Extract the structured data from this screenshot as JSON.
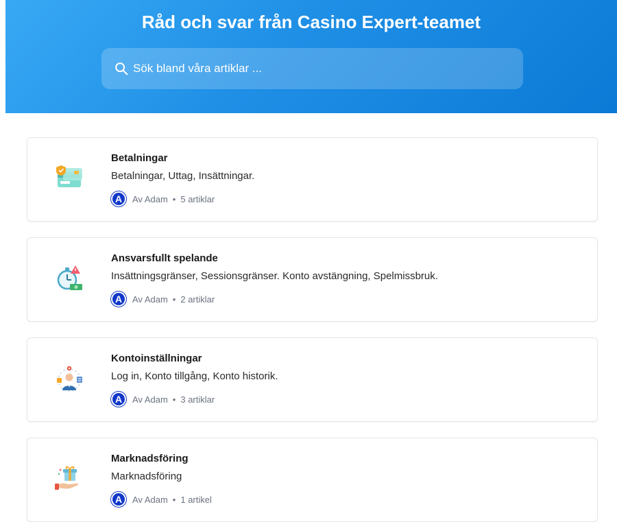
{
  "header": {
    "title": "Råd och svar från Casino Expert-teamet",
    "search_placeholder": "Sök bland våra artiklar ..."
  },
  "categories": [
    {
      "title": "Betalningar",
      "description": "Betalningar, Uttag, Insättningar.",
      "author_initial": "A",
      "author": "Av Adam",
      "separator": "•",
      "count": "5 artiklar",
      "icon": "payment-card-icon"
    },
    {
      "title": "Ansvarsfullt spelande",
      "description": "Insättningsgränser, Sessionsgränser. Konto avstängning, Spelmissbruk.",
      "author_initial": "A",
      "author": "Av Adam",
      "separator": "•",
      "count": "2 artiklar",
      "icon": "stopwatch-money-icon"
    },
    {
      "title": "Kontoinställningar",
      "description": "Log in, Konto tillgång, Konto historik.",
      "author_initial": "A",
      "author": "Av Adam",
      "separator": "•",
      "count": "3 artiklar",
      "icon": "user-settings-icon"
    },
    {
      "title": "Marknadsföring",
      "description": "Marknadsföring",
      "author_initial": "A",
      "author": "Av Adam",
      "separator": "•",
      "count": "1 artikel",
      "icon": "gift-hand-icon"
    }
  ],
  "colors": {
    "hero_start": "#38a9f4",
    "hero_end": "#0a7ad6",
    "avatar": "#1238c9"
  }
}
